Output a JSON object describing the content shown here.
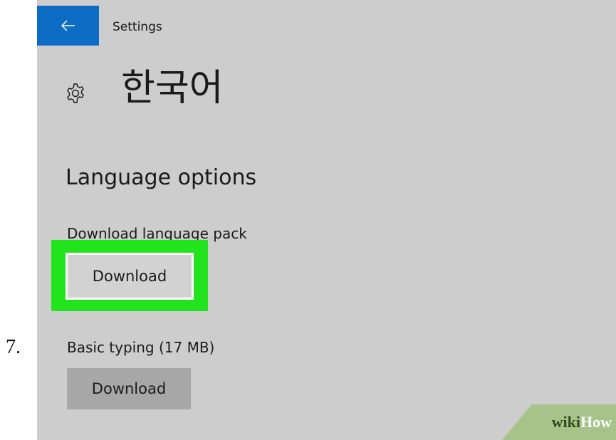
{
  "step": {
    "number": "7."
  },
  "window": {
    "title": "Settings",
    "back_icon": "back-arrow-icon"
  },
  "page": {
    "title": "한국어",
    "title_icon": "gear-icon"
  },
  "language_options": {
    "heading": "Language options",
    "language_pack": {
      "label": "Download language pack",
      "button_label": "Download"
    },
    "basic_typing": {
      "label": "Basic typing (17 MB)",
      "button_label": "Download"
    }
  },
  "watermark": {
    "part1": "wiki",
    "part2": "How"
  },
  "colors": {
    "accent": "#0d6cc4",
    "highlight": "#22e41c",
    "panel_bg": "#cdcdcd"
  }
}
